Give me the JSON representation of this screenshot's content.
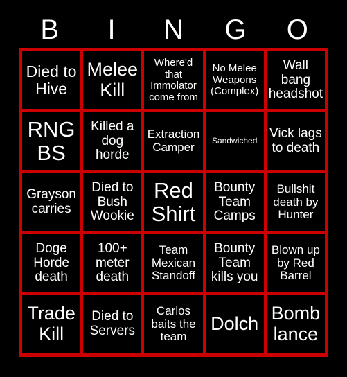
{
  "card": {
    "header_letters": [
      "B",
      "I",
      "N",
      "G",
      "O"
    ],
    "colors": {
      "background": "#000000",
      "border": "#cc0000",
      "text": "#ffffff"
    },
    "cells": [
      {
        "text": "Died to Hive",
        "size": "lg"
      },
      {
        "text": "Melee Kill",
        "size": "xl"
      },
      {
        "text": "Where'd that Immolator come from",
        "size": "xs"
      },
      {
        "text": "No Melee Weapons (Complex)",
        "size": "xs"
      },
      {
        "text": "Wall bang headshot",
        "size": "md"
      },
      {
        "text": "RNG BS",
        "size": "xxl"
      },
      {
        "text": "Killed a dog horde",
        "size": "md"
      },
      {
        "text": "Extraction Camper",
        "size": "sm"
      },
      {
        "text": "Sandwiched",
        "size": "xxs"
      },
      {
        "text": "Vick lags to death",
        "size": "md"
      },
      {
        "text": "Grayson carries",
        "size": "md"
      },
      {
        "text": "Died to Bush Wookie",
        "size": "md"
      },
      {
        "text": "Red Shirt",
        "size": "xxl"
      },
      {
        "text": "Bounty Team Camps",
        "size": "md"
      },
      {
        "text": "Bullshit death by Hunter",
        "size": "sm"
      },
      {
        "text": "Doge Horde death",
        "size": "md"
      },
      {
        "text": "100+ meter death",
        "size": "md"
      },
      {
        "text": "Team Mexican Standoff",
        "size": "sm"
      },
      {
        "text": "Bounty Team kills you",
        "size": "md"
      },
      {
        "text": "Blown up by Red Barrel",
        "size": "sm"
      },
      {
        "text": "Trade Kill",
        "size": "xl"
      },
      {
        "text": "Died to Servers",
        "size": "md"
      },
      {
        "text": "Carlos baits the team",
        "size": "sm"
      },
      {
        "text": "Dolch",
        "size": "xl"
      },
      {
        "text": "Bomb lance",
        "size": "xl"
      }
    ]
  }
}
